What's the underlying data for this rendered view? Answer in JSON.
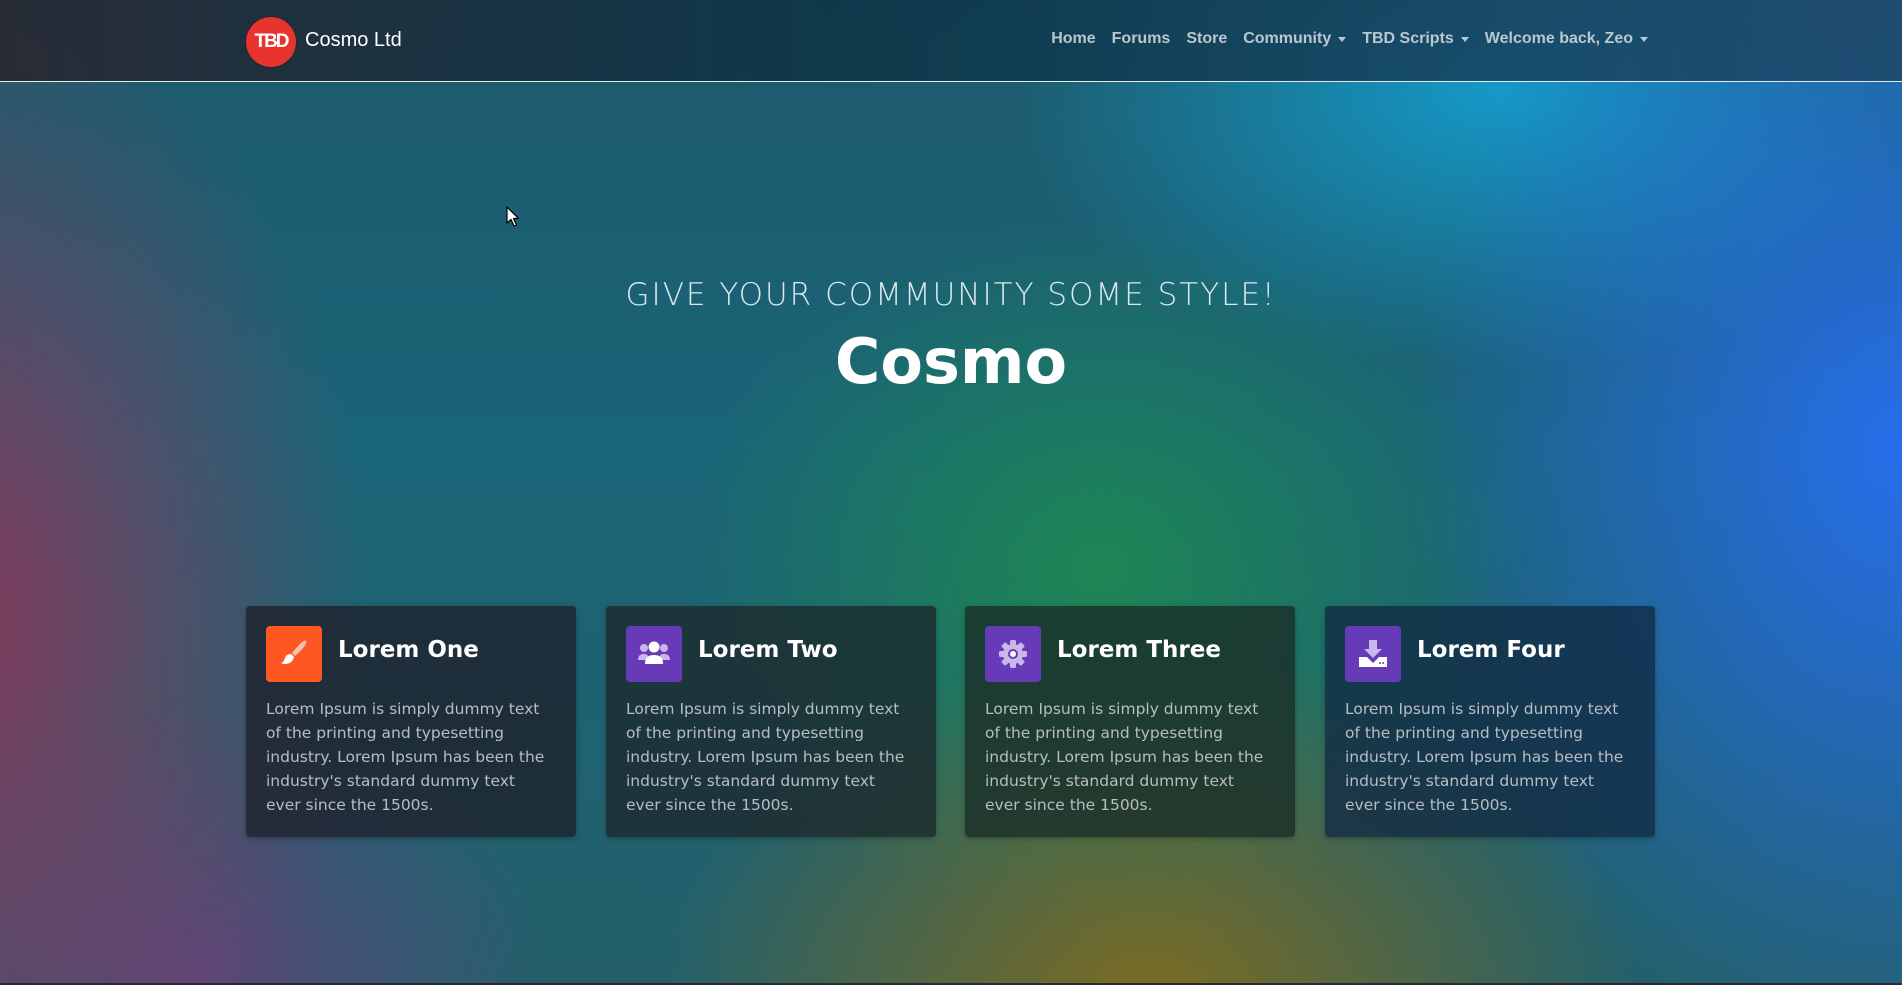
{
  "brand": {
    "logo_text": "TBD",
    "name": "Cosmo Ltd"
  },
  "nav": {
    "items": [
      {
        "label": "Home",
        "dropdown": false
      },
      {
        "label": "Forums",
        "dropdown": false
      },
      {
        "label": "Store",
        "dropdown": false
      },
      {
        "label": "Community",
        "dropdown": true
      },
      {
        "label": "TBD Scripts",
        "dropdown": true
      },
      {
        "label": "Welcome back, Zeo",
        "dropdown": true
      }
    ]
  },
  "hero": {
    "subtitle": "GIVE YOUR COMMUNITY SOME STYLE!",
    "title": "Cosmo"
  },
  "cards": [
    {
      "title": "Lorem One",
      "icon": "paint-brush-icon",
      "icon_color": "#ff5722",
      "text": "Lorem Ipsum is simply dummy text of the printing and typesetting industry. Lorem Ipsum has been the industry's standard dummy text ever since the 1500s."
    },
    {
      "title": "Lorem Two",
      "icon": "users-icon",
      "icon_color": "#673ab7",
      "text": "Lorem Ipsum is simply dummy text of the printing and typesetting industry. Lorem Ipsum has been the industry's standard dummy text ever since the 1500s."
    },
    {
      "title": "Lorem Three",
      "icon": "gear-icon",
      "icon_color": "#673ab7",
      "text": "Lorem Ipsum is simply dummy text of the printing and typesetting industry. Lorem Ipsum has been the industry's standard dummy text ever since the 1500s."
    },
    {
      "title": "Lorem Four",
      "icon": "download-icon",
      "icon_color": "#673ab7",
      "text": "Lorem Ipsum is simply dummy text of the printing and typesetting industry. Lorem Ipsum has been the industry's standard dummy text ever since the 1500s."
    }
  ],
  "colors": {
    "logo_red": "#e8342f",
    "nav_text": "#b9c7cf",
    "card_text": "#b7bdc4"
  }
}
